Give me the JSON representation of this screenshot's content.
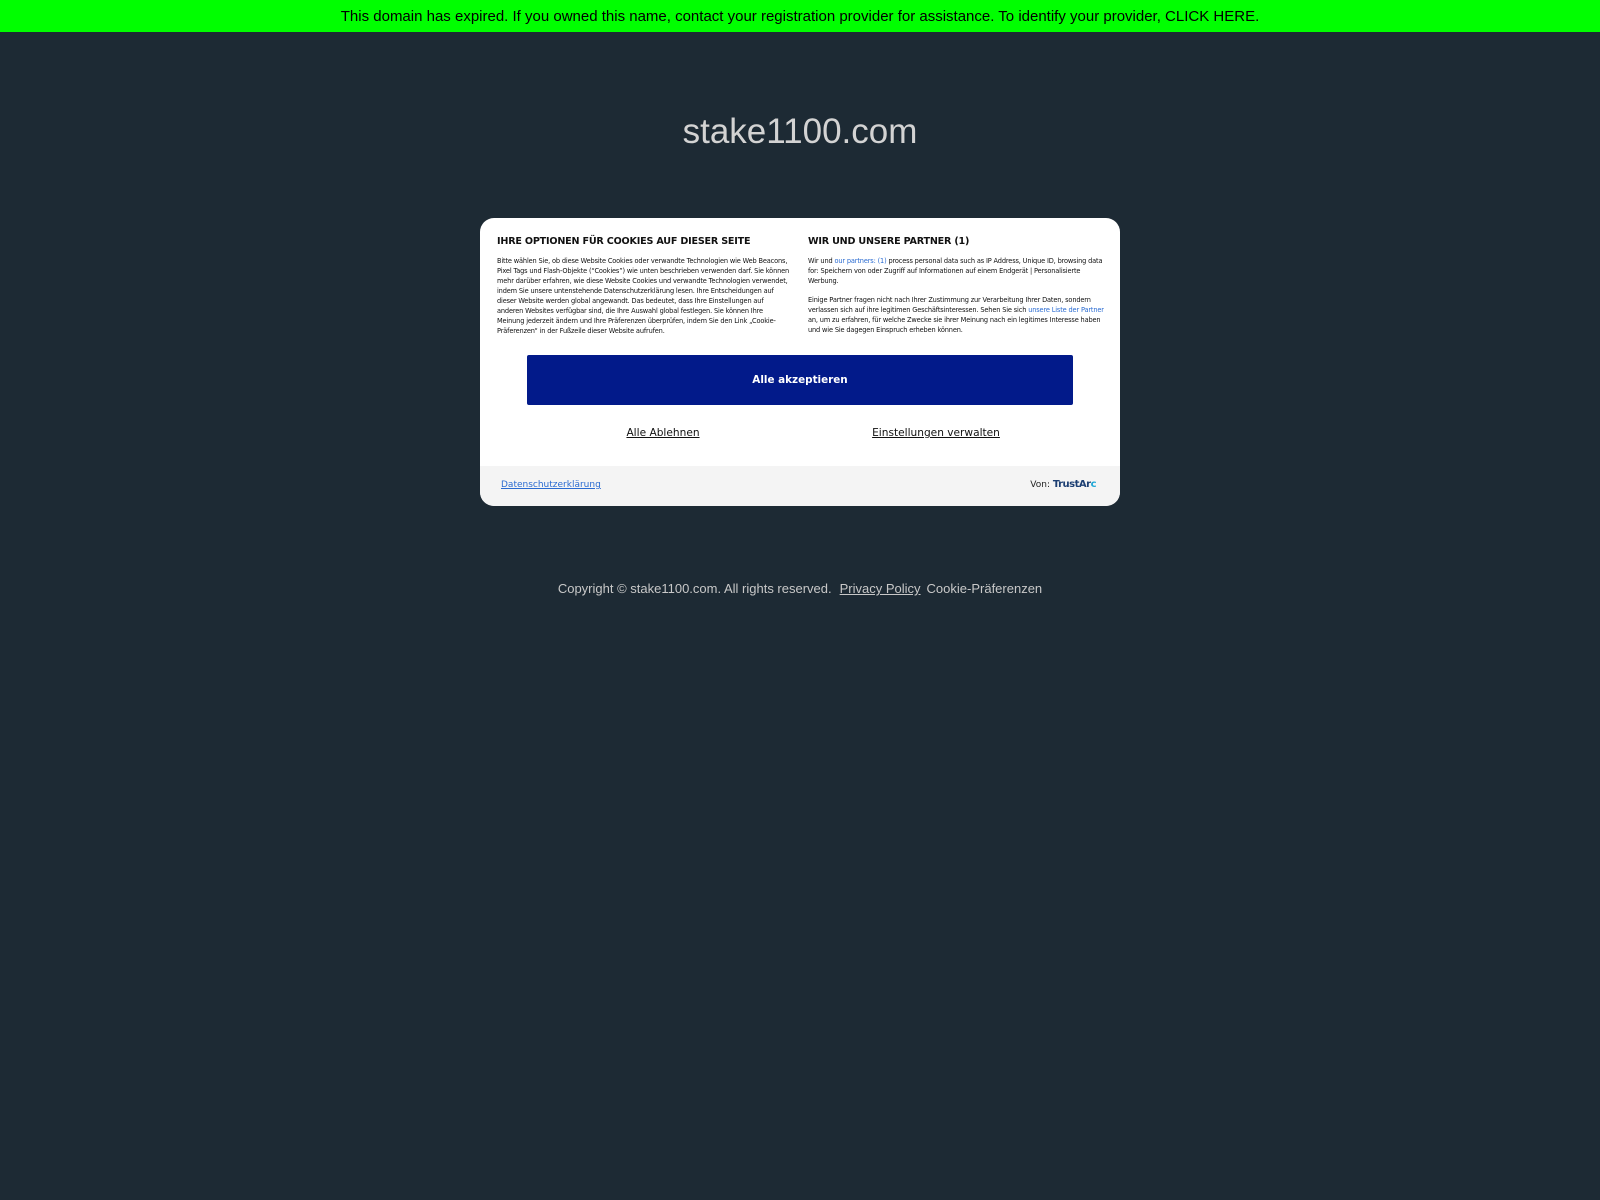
{
  "banner": {
    "text": "This domain has expired. If you owned this name, contact your registration provider for assistance. To identify your provider, CLICK HERE.",
    "background": "#00ff00"
  },
  "domain": {
    "title": "stake1100.com"
  },
  "cookie_dialog": {
    "left": {
      "heading": "IHRE OPTIONEN FÜR COOKIES AUF DIESER SEITE",
      "body": "Bitte wählen Sie, ob diese Website Cookies oder verwandte Technologien wie Web Beacons, Pixel Tags und Flash-Objekte (“Cookies”) wie unten beschrieben verwenden darf. Sie können mehr darüber erfahren, wie diese Website Cookies und verwandte Technologien verwendet, indem Sie unsere untenstehende Datenschutzerklärung lesen. Ihre Entscheidungen auf dieser Website werden global angewandt. Das bedeutet, dass Ihre Einstellungen auf anderen Websites verfügbar sind, die Ihre Auswahl global festlegen. Sie können Ihre Meinung jederzeit ändern und Ihre Präferenzen überprüfen, indem Sie den Link „Cookie-Präferenzen“ in der Fußzeile dieser Website aufrufen."
    },
    "right": {
      "heading": "WIR UND UNSERE PARTNER (1)",
      "p1_prefix": "Wir und ",
      "p1_link": "our partners: (1)",
      "p1_suffix": " process personal data such as IP Address, Unique ID, browsing data for: Speichern von oder Zugriff auf Informationen auf einem Endgerät | Personalisierte Werbung.",
      "p2_prefix": "Einige Partner fragen nicht nach Ihrer Zustimmung zur Verarbeitung Ihrer Daten, sondern verlassen sich auf ihre legitimen Geschäftsinteressen. Sehen Sie sich ",
      "p2_link": "unsere Liste der Partner",
      "p2_suffix": " an, um zu erfahren, für welche Zwecke sie ihrer Meinung nach ein legitimes Interesse haben und wie Sie dagegen Einspruch erheben können."
    },
    "accept_label": "Alle akzeptieren",
    "reject_label": "Alle Ablehnen",
    "manage_label": "Einstellungen verwalten",
    "footer": {
      "privacy_label": "Datenschutzerklärung",
      "by_label": "Von:",
      "brand_main": "TrustAr",
      "brand_tail": "c"
    },
    "accent_color": "#021a8a",
    "link_color": "#2a6bd1"
  },
  "page_footer": {
    "copyright": "Copyright © stake1100.com.  All rights reserved.",
    "privacy_policy": "Privacy Policy",
    "cookie_prefs": "Cookie-Präferenzen"
  }
}
